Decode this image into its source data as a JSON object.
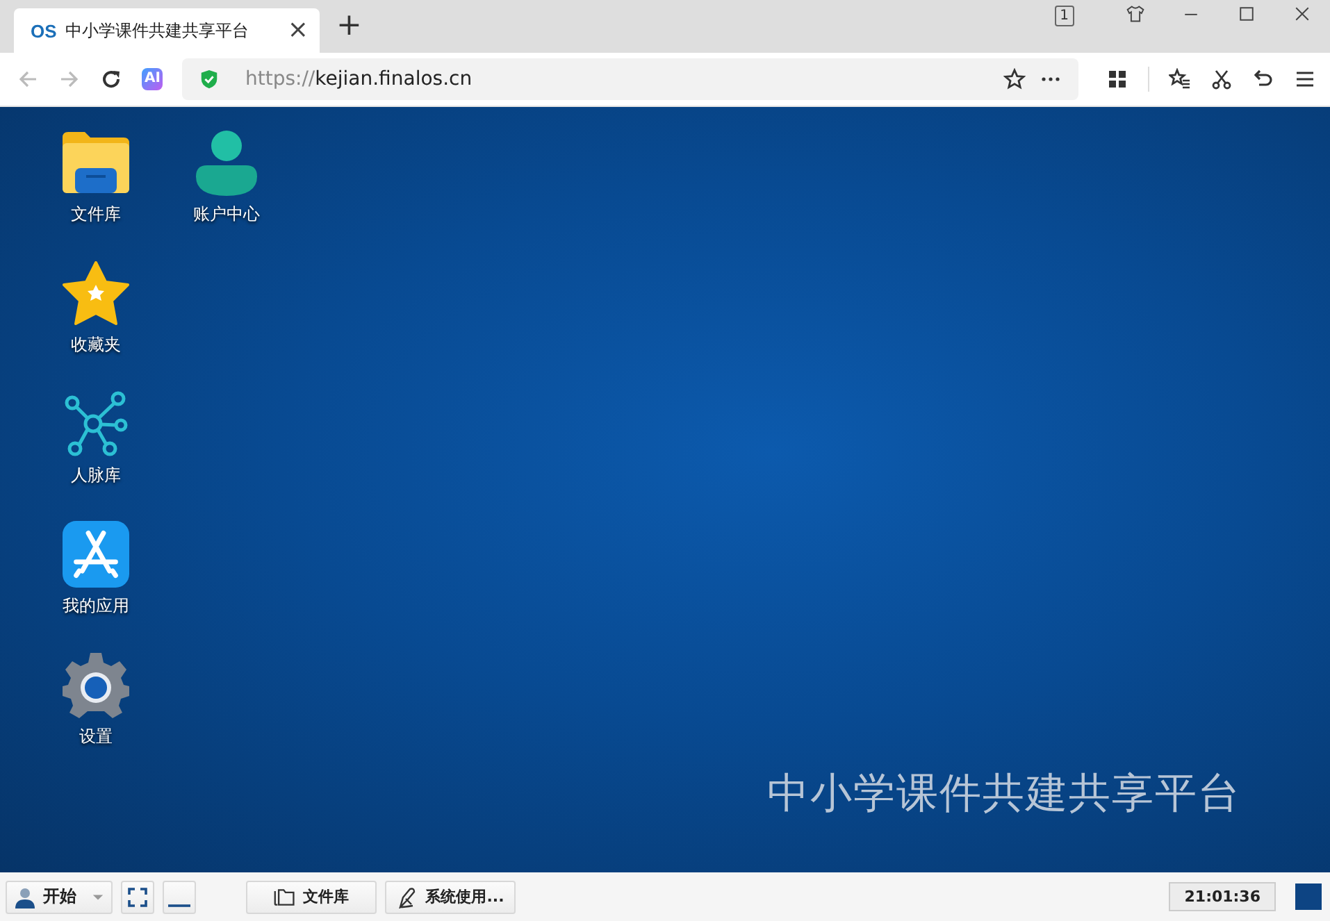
{
  "browser": {
    "tab": {
      "logo": "OS",
      "title": "中小学课件共建共享平台",
      "close": "×"
    },
    "new_tab": "+",
    "tab_count": "1",
    "url_scheme": "https://",
    "url_host": "kejian.finalos.cn",
    "ai_badge": "AI"
  },
  "desktop": {
    "icons": [
      {
        "kind": "folder",
        "label": "文件库"
      },
      {
        "kind": "star",
        "label": "收藏夹"
      },
      {
        "kind": "network",
        "label": "人脉库"
      },
      {
        "kind": "apps",
        "label": "我的应用"
      },
      {
        "kind": "gear",
        "label": "设置"
      },
      {
        "kind": "user",
        "label": "账户中心"
      }
    ],
    "platform_title": "中小学课件共建共享平台"
  },
  "taskbar": {
    "start": "开始",
    "tasks": [
      {
        "kind": "folder",
        "label": "文件库"
      },
      {
        "kind": "pen",
        "label": "系统使用..."
      }
    ],
    "clock": "21:01:36"
  }
}
